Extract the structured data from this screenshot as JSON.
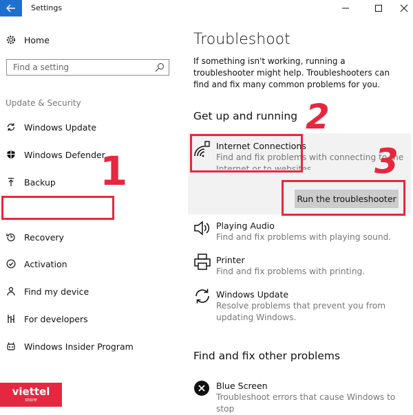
{
  "window": {
    "title": "Settings"
  },
  "sidebar": {
    "home": "Home",
    "search_placeholder": "Find a setting",
    "section": "Update & Security",
    "items": [
      {
        "label": "Windows Update",
        "icon": "refresh-icon"
      },
      {
        "label": "Windows Defender",
        "icon": "shield-icon"
      },
      {
        "label": "Backup",
        "icon": "backup-arrow-icon"
      },
      {
        "label": "",
        "icon": ""
      },
      {
        "label": "Recovery",
        "icon": "recovery-icon"
      },
      {
        "label": "Activation",
        "icon": "check-circle-icon"
      },
      {
        "label": "Find my device",
        "icon": "person-pin-icon"
      },
      {
        "label": "For developers",
        "icon": "developer-tools-icon"
      },
      {
        "label": "Windows Insider Program",
        "icon": "insider-icon"
      }
    ]
  },
  "main": {
    "title": "Troubleshoot",
    "description": "If something isn't working, running a troubleshooter might help. Troubleshooters can find and fix many common problems for you.",
    "section1": "Get up and running",
    "items": [
      {
        "title": "Internet Connections",
        "desc1": "Find and fix problems with connecting to the",
        "desc2": "Internet or to websites.",
        "icon": "wifi-icon"
      },
      {
        "title": "Playing Audio",
        "desc1": "Find and fix problems with playing sound.",
        "icon": "speaker-icon"
      },
      {
        "title": "Printer",
        "desc1": "Find and fix problems with printing.",
        "icon": "printer-icon"
      },
      {
        "title": "Windows Update",
        "desc1": "Resolve problems that prevent you from",
        "desc2": "updating Windows.",
        "icon": "refresh-icon"
      }
    ],
    "run_button": "Run the troubleshooter",
    "section2": "Find and fix other problems",
    "other_items": [
      {
        "title": "Blue Screen",
        "desc1": "Troubleshoot errors that cause Windows to stop",
        "icon": "error-x-icon"
      }
    ]
  },
  "annotations": {
    "n1": "1",
    "n2": "2",
    "n3": "3",
    "color": "#e5283f"
  },
  "watermark": {
    "brand": "viettel",
    "sub": "store",
    "color": "#e5283f"
  }
}
